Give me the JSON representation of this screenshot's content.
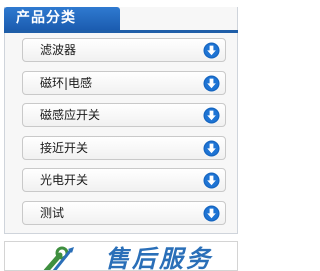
{
  "header": {
    "title": "产品分类"
  },
  "menu": {
    "items": [
      {
        "label": "滤波器",
        "icon": "circle-arrow-down-icon"
      },
      {
        "label": "磁环|电感",
        "icon": "circle-arrow-down-icon"
      },
      {
        "label": "磁感应开关",
        "icon": "circle-arrow-down-icon"
      },
      {
        "label": "接近开关",
        "icon": "circle-arrow-down-icon"
      },
      {
        "label": "光电开关",
        "icon": "circle-arrow-down-icon"
      },
      {
        "label": "测试",
        "icon": "circle-arrow-down-icon"
      }
    ]
  },
  "service": {
    "text": "售后服务",
    "icon": "wrench-screwdriver-icon"
  },
  "colors": {
    "accent": "#1f5ea8",
    "icon_blue": "#1565c0"
  }
}
